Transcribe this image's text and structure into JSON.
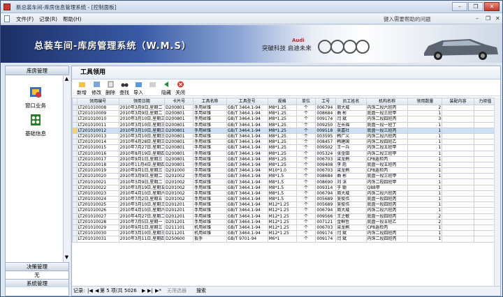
{
  "window": {
    "title": "新总装车间-库房信息管理系统 - [控制面板]",
    "minimize": "–",
    "restore": "❐",
    "close": "✕"
  },
  "menu": {
    "items": [
      "文件(F)",
      "记录(R)",
      "帮助(H)"
    ],
    "help_placeholder": "键入需要帮助的问题",
    "doc_min": "–",
    "doc_restore": "❐",
    "doc_close": "✕"
  },
  "banner": {
    "title": "总装车间-库房管理系统（W.M.S）",
    "slogan": "突破科技  启迪未来",
    "brand": "Audi"
  },
  "sidebar": {
    "header": "库房管理",
    "items": [
      {
        "label": "窗口业务",
        "icon": "window-business-icon"
      },
      {
        "label": "基础信息",
        "icon": "basic-info-icon"
      }
    ],
    "footer": [
      "决策管理",
      "无",
      "系统管理"
    ]
  },
  "main": {
    "caption": "工具领用"
  },
  "toolbar": [
    "新增",
    "修改",
    "删除",
    "查找",
    "导入",
    "",
    "隐藏",
    "关闭"
  ],
  "table": {
    "columns": [
      "领用编号",
      "领用日期",
      "卡片号",
      "工具名称",
      "工具型号",
      "规格",
      "单位",
      "工号",
      "员工姓名",
      "机构名称",
      "领用数量",
      "装配内容",
      "力矩值"
    ],
    "rows": [
      [
        "LT201010008",
        "2010年3月9日,星期二",
        "D200801",
        "手用丝锥",
        "GB/T 3464.1-94",
        "M8*1.25",
        "个",
        "006794",
        "周大威",
        "内饰二段六班丙",
        "2",
        "",
        ""
      ],
      [
        "LT201010009",
        "2010年3月9日,星期二",
        "D200801",
        "手用丝锥",
        "GB/T 3464.1-94",
        "M8*1.25",
        "个",
        "008684",
        "曲  彬",
        "底盘一段三班甲",
        "1",
        "",
        ""
      ],
      [
        "LT201010010",
        "2010年3月10日,星期三",
        "D200801",
        "手用丝锥",
        "GB/T 3464.1-94",
        "M8*1.25",
        "个",
        "009174",
        "闫  斌",
        "内饰二段四班丙",
        "3",
        "",
        ""
      ],
      [
        "LT201010011",
        "2010年3月10日,星期三",
        "D200801",
        "手用丝锥",
        "GB/T 3464.1-94",
        "M8*1.25",
        "个",
        "009250",
        "左长福",
        "底盘一段一班丁",
        "1",
        "",
        ""
      ],
      [
        "LT201010012",
        "2010年3月10日,星期三",
        "D200801",
        "手用丝锥",
        "GB/T 3464.1-94",
        "M8*1.25",
        "个",
        "009518",
        "吴嘉社",
        "底盘一段三班丙",
        "1",
        "",
        ""
      ],
      [
        "LT201010013",
        "2010年3月10日,星期三",
        "D200801",
        "手用丝锥",
        "GB/T 3464.1-94",
        "M8*1.25",
        "个",
        "003595",
        "韩广义",
        "内饰二段六班丙",
        "1",
        "",
        ""
      ],
      [
        "LT201010014",
        "2010年4月28日,星期三",
        "D200801",
        "手用丝锥",
        "GB/T 3464.1-94",
        "M8*1.25",
        "个",
        "008457",
        "韩建国",
        "内饰二段四班乙",
        "1",
        "",
        ""
      ],
      [
        "LT201010015",
        "2010年7月27日,星期二",
        "D200801",
        "手用丝锥",
        "GB/T 3464.1-94",
        "M8*1.25",
        "个",
        "009502",
        "王一兵",
        "内饰二段五班甲",
        "1",
        "",
        ""
      ],
      [
        "LT201010016",
        "2010年8月19日,星期四",
        "D200801",
        "手用丝锥",
        "GB/T 3464.1-94",
        "M8*1.25",
        "个",
        "005324",
        "张金田",
        "内饰二段三班甲",
        "1",
        "",
        ""
      ],
      [
        "LT201010017",
        "2010年9月1日,星期三",
        "D200801",
        "手用丝锥",
        "GB/T 3464.1-94",
        "M8*1.25",
        "个",
        "006703",
        "梁龙鹃",
        "CP8返检丙",
        "1",
        "",
        ""
      ],
      [
        "LT201010018",
        "2010年11月4日,星期四",
        "D200801",
        "手用丝锥",
        "GB/T 3464.1-94",
        "M8*1.25",
        "个",
        "009408",
        "李  彪",
        "底盘一段五班丙",
        "1",
        "",
        ""
      ],
      [
        "LT201010019",
        "2010年9月1日,星期三",
        "D201000",
        "手用丝锥",
        "GB/T 3464.1-94",
        "M10*1.0",
        "个",
        "006703",
        "梁龙鹃",
        "CP8返检丙",
        "1",
        "",
        ""
      ],
      [
        "LT201010020",
        "2010年3月9日,星期二",
        "D201002",
        "手用丝锥",
        "GB/T 3464.1-94",
        "M8*1.5",
        "个",
        "008684",
        "曲  彬",
        "底盘一段三班甲",
        "1",
        "",
        ""
      ],
      [
        "LT201010021",
        "2010年3月9日,星期二",
        "D201002",
        "手用丝锥",
        "GB/T 3464.1-94",
        "M8*1.5",
        "个",
        "008690",
        "刘  沫",
        "内饰二段四班甲",
        "1",
        "",
        ""
      ],
      [
        "LT201010022",
        "2010年3月19日,星期五",
        "D201002",
        "手用丝锥",
        "GB/T 3464.1-94",
        "M8*1.5",
        "个",
        "009314",
        "于  聪",
        "Q88甲",
        "1",
        "",
        ""
      ],
      [
        "LT201010023",
        "2010年4月10日,星期六",
        "D201002",
        "手用丝锥",
        "GB/T 3464.1-94",
        "M8*1.5",
        "个",
        "006794",
        "周大威",
        "内饰二段六班丙",
        "1",
        "",
        ""
      ],
      [
        "LT201010024",
        "2010年7月2日,星期五",
        "D201002",
        "手用丝锥",
        "GB/T 3464.1-94",
        "M8*1.5",
        "个",
        "005689",
        "吴俊伟",
        "底盘一段四班丙",
        "1",
        "",
        ""
      ],
      [
        "LT201010025",
        "2010年3月10日,星期三",
        "D201201",
        "手用丝锥",
        "GB/T 3464.1-94",
        "M12*1.25",
        "个",
        "005689",
        "吴俊伟",
        "底盘一段四班丙",
        "1",
        "",
        ""
      ],
      [
        "LT201010026",
        "2010年4月10日,星期六",
        "D201201",
        "手用丝锥",
        "GB/T 3464.1-94",
        "M12*1.25",
        "个",
        "006794",
        "周大威",
        "内饰二段六班丙",
        "1",
        "",
        ""
      ],
      [
        "LT201010027",
        "2010年4月27日,星期二",
        "D201201",
        "手用丝锥",
        "GB/T 3464.1-94",
        "M12*1.25",
        "个",
        "009566",
        "王之敏",
        "底盘一段四班丙",
        "2",
        "",
        ""
      ],
      [
        "LT201010028",
        "2010年7月5日,星期一",
        "D201201",
        "手用丝锥",
        "GB/T 3464.1-94",
        "M12*1.25",
        "个",
        "007121",
        "金鲜哲",
        "底盘一段五班乙",
        "2",
        "",
        ""
      ],
      [
        "LT201010029",
        "2010年9月1日,星期三",
        "D211101",
        "机用丝锥",
        "GB/T 3464.1-94",
        "M12*1.25",
        "个",
        "006703",
        "梁龙鹃",
        "CP8返检丙",
        "1",
        "",
        ""
      ],
      [
        "LT201010030",
        "2010年3月10日,星期三",
        "D211201",
        "机用丝锥",
        "GB/T 3464.1-94",
        "M12*1.25",
        "个",
        "009174",
        "闫  斌",
        "内饰二段四班丙",
        "1",
        "",
        ""
      ],
      [
        "LT201010031",
        "2010年3月11日,星期四",
        "D250600",
        "扳手",
        "GB/T 9701-94",
        "M6*1",
        "个",
        "009174",
        "闫  斌",
        "内饰二段四班丙",
        "1",
        "",
        ""
      ]
    ]
  },
  "status": {
    "label": "记录:",
    "first": "|◀",
    "prev": "◀",
    "position": "第 5 项(共 5026",
    "next": "▶",
    "last": "▶|",
    "new": "▶*",
    "filter": "无筛选器",
    "search": "搜索"
  },
  "colors": {
    "selection": "#cfe0f4",
    "indicator": "#f3d17d",
    "banner_left": "#1c2f66"
  }
}
